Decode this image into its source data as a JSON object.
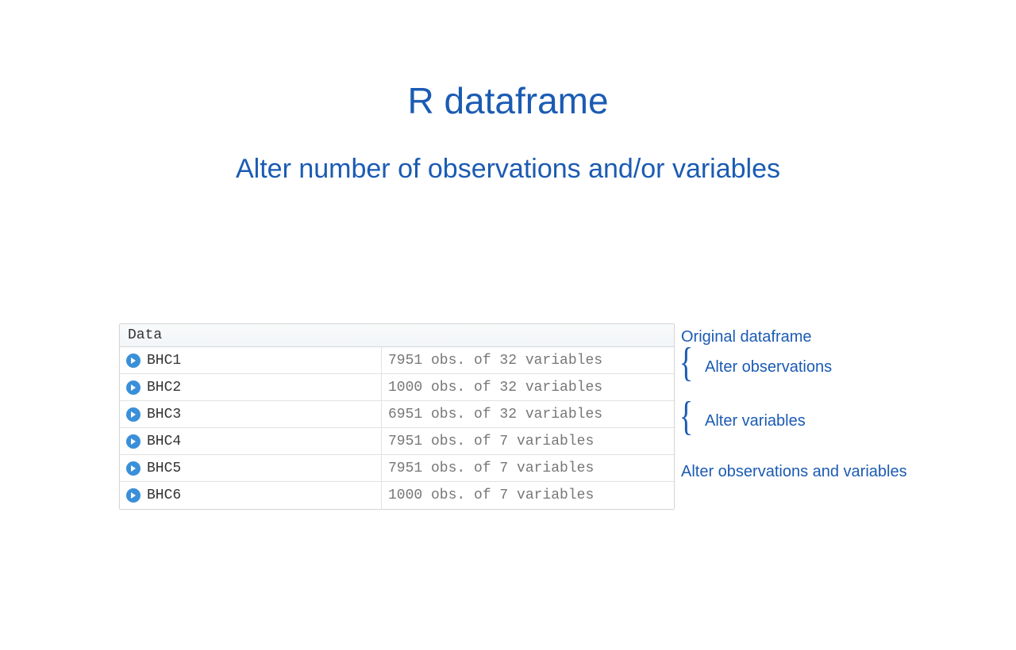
{
  "title": "R dataframe",
  "subtitle": "Alter number of observations and/or variables",
  "panel_header": "Data",
  "rows": [
    {
      "name": "BHC1",
      "desc": "7951 obs. of 32 variables"
    },
    {
      "name": "BHC2",
      "desc": "1000 obs. of 32 variables"
    },
    {
      "name": "BHC3",
      "desc": "6951 obs. of 32 variables"
    },
    {
      "name": "BHC4",
      "desc": "7951 obs. of 7 variables"
    },
    {
      "name": "BHC5",
      "desc": "7951 obs. of 7 variables"
    },
    {
      "name": "BHC6",
      "desc": "1000 obs. of 7 variables"
    }
  ],
  "annotations": {
    "original": "Original dataframe",
    "alter_obs": "Alter observations",
    "alter_vars": "Alter variables",
    "alter_both": "Alter observations and variables"
  },
  "brace": "{"
}
